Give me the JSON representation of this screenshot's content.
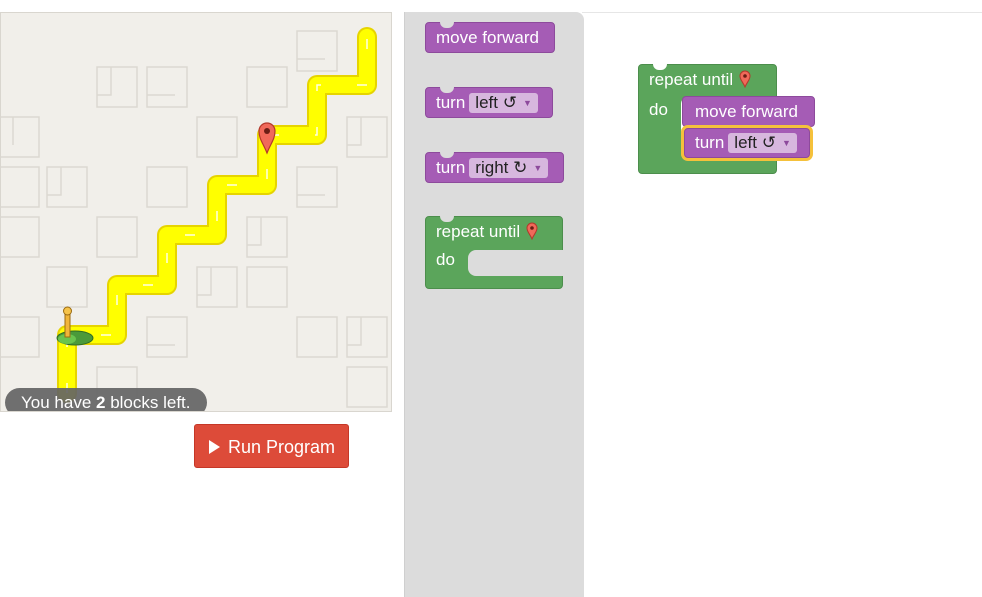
{
  "status": {
    "prefix": "You have ",
    "count": "2",
    "suffix": " blocks left."
  },
  "run_button": {
    "label": "Run Program"
  },
  "toolbox": {
    "move_forward": "move forward",
    "turn_left": {
      "label": "turn",
      "value": "left ↺"
    },
    "turn_right": {
      "label": "turn",
      "value": "right ↻"
    },
    "repeat": {
      "label": "repeat until",
      "do": "do"
    }
  },
  "workspace": {
    "repeat": {
      "label": "repeat until",
      "do": "do"
    },
    "move_forward": "move forward",
    "turn": {
      "label": "turn",
      "value": "left ↺"
    }
  },
  "colors": {
    "path": "#ffff00",
    "run_button": "#dd4b39",
    "motion_block": "#a55cb5",
    "loop_block": "#5ba55b",
    "selection": "#f5c13b"
  }
}
